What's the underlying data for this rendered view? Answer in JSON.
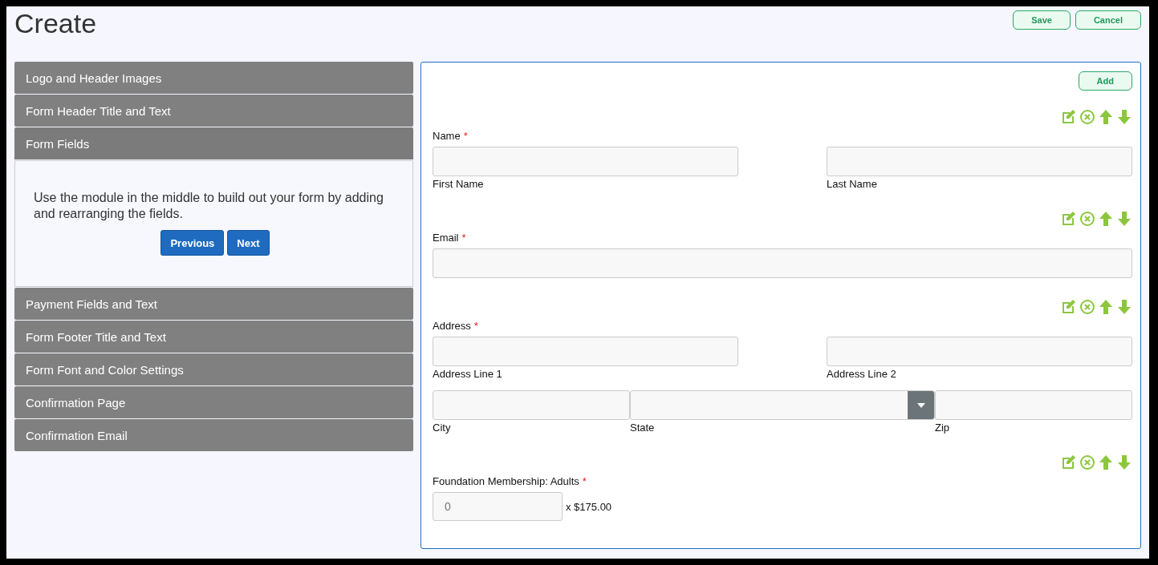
{
  "title": "Create",
  "actions": [
    {
      "label": "Save"
    },
    {
      "label": "Cancel"
    }
  ],
  "sections": [
    {
      "label": "Logo and Header Images",
      "expanded": false
    },
    {
      "label": "Form Header Title and Text",
      "expanded": false
    },
    {
      "label": "Form Fields",
      "expanded": true,
      "text": "Use the module in the middle to build out your form by adding and rearranging the fields.",
      "buttons": [
        {
          "label": "Previous"
        },
        {
          "label": "Next"
        }
      ]
    },
    {
      "label": "Payment Fields and Text",
      "expanded": false
    },
    {
      "label": "Form Footer Title and Text",
      "expanded": false
    },
    {
      "label": "Form Font and Color Settings",
      "expanded": false
    },
    {
      "label": "Confirmation Page",
      "expanded": false
    },
    {
      "label": "Confirmation Email",
      "expanded": false
    }
  ],
  "builder": {
    "add_button": "Add",
    "fields": [
      {
        "label": "Name",
        "required_mark": "*",
        "rows": [
          [
            {
              "kind": "text",
              "sublabel": "First Name"
            },
            {
              "kind": "text",
              "sublabel": "Last Name"
            }
          ]
        ]
      },
      {
        "label": "Email",
        "required_mark": "*",
        "rows": [
          [
            {
              "kind": "text"
            }
          ]
        ]
      },
      {
        "label": "Address",
        "required_mark": "*",
        "rows": [
          [
            {
              "kind": "text",
              "sublabel": "Address Line 1"
            },
            {
              "kind": "text",
              "sublabel": "Address Line 2"
            }
          ],
          [
            {
              "kind": "text",
              "sublabel": "City"
            },
            {
              "kind": "select",
              "sublabel": "State"
            },
            {
              "kind": "text",
              "sublabel": "Zip"
            }
          ]
        ]
      },
      {
        "label": "Foundation Membership: Adults",
        "required_mark": "*",
        "rows": [
          [
            {
              "kind": "quantity",
              "placeholder": "0",
              "suffix": "x $175.00"
            }
          ]
        ]
      }
    ]
  }
}
